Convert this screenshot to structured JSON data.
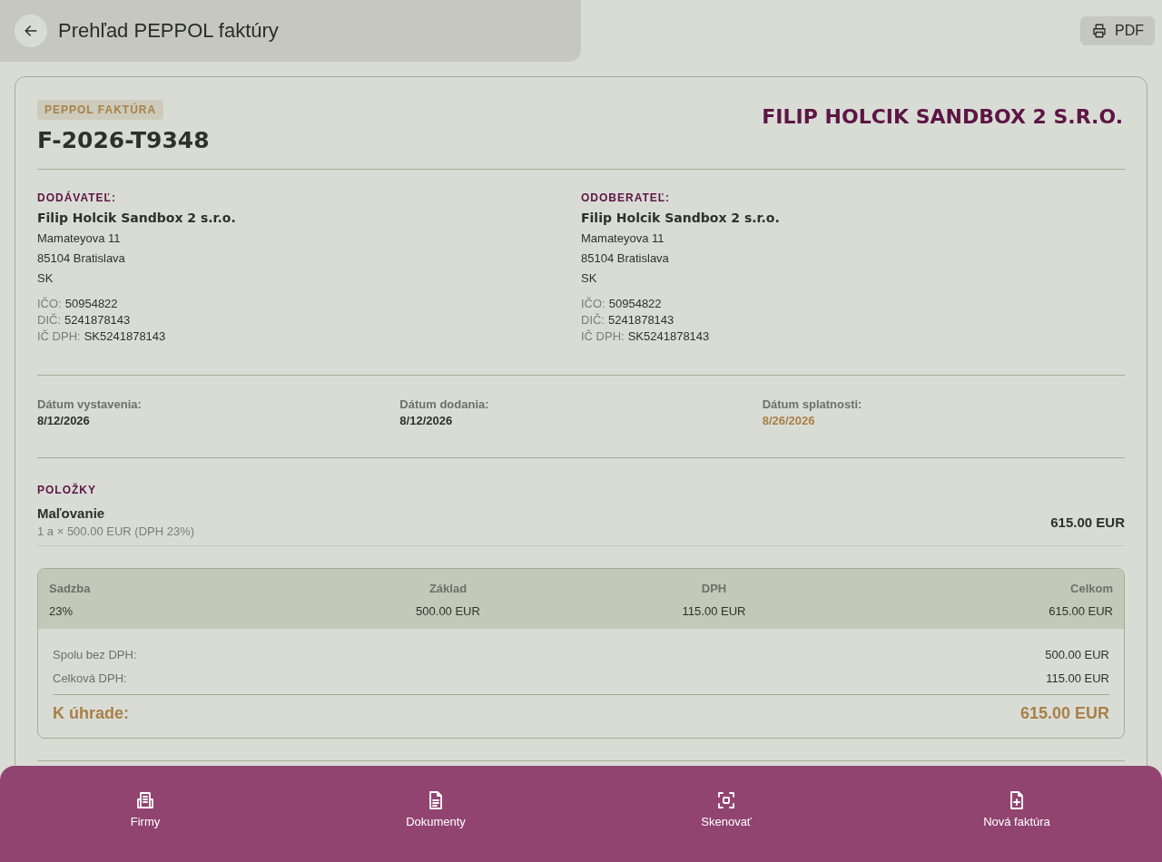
{
  "header": {
    "title": "Prehľad PEPPOL faktúry",
    "pdf_button": "PDF"
  },
  "invoice": {
    "badge": "PEPPOL FAKTÚRA",
    "number": "F-2026-T9348",
    "company": "FILIP HOLCIK SANDBOX 2 S.R.O."
  },
  "parties": [
    {
      "label": "DODÁVATEĽ:",
      "name": "Filip Holcik Sandbox 2 s.r.o.",
      "address": [
        "Mamateyova 11",
        "85104 Bratislava",
        "SK"
      ],
      "ids": [
        {
          "label": "IČO:",
          "value": "50954822"
        },
        {
          "label": "DIČ:",
          "value": "5241878143"
        },
        {
          "label": "IČ DPH:",
          "value": "SK5241878143"
        }
      ]
    },
    {
      "label": "ODOBERATEĽ:",
      "name": "Filip Holcik Sandbox 2 s.r.o.",
      "address": [
        "Mamateyova 11",
        "85104 Bratislava",
        "SK"
      ],
      "ids": [
        {
          "label": "IČO:",
          "value": "50954822"
        },
        {
          "label": "DIČ:",
          "value": "5241878143"
        },
        {
          "label": "IČ DPH:",
          "value": "SK5241878143"
        }
      ]
    }
  ],
  "dates": [
    {
      "label": "Dátum vystavenia:",
      "value": "8/12/2026",
      "highlighted": false
    },
    {
      "label": "Dátum dodania:",
      "value": "8/12/2026",
      "highlighted": false
    },
    {
      "label": "Dátum splatnosti:",
      "value": "8/26/2026",
      "highlighted": true
    }
  ],
  "items_heading": "POLOŽKY",
  "items": [
    {
      "name": "Maľovanie",
      "detail": "1 a × 500.00 EUR (DPH 23%)",
      "total": "615.00 EUR"
    }
  ],
  "vat_table": {
    "columns": [
      "Sadzba",
      "Základ",
      "DPH",
      "Celkom"
    ],
    "rows": [
      [
        "23%",
        "500.00 EUR",
        "115.00 EUR",
        "615.00 EUR"
      ]
    ]
  },
  "summary": [
    {
      "label": "Spolu bez DPH:",
      "value": "500.00 EUR"
    },
    {
      "label": "Celková DPH:",
      "value": "115.00 EUR"
    }
  ],
  "total": {
    "label": "K úhrade:",
    "value": "615.00 EUR"
  },
  "nav": [
    {
      "label": "Firmy",
      "kind": "companies"
    },
    {
      "label": "Dokumenty",
      "kind": "document"
    },
    {
      "label": "Skenovať",
      "kind": "scan"
    },
    {
      "label": "Nová faktúra",
      "kind": "new-file"
    }
  ]
}
